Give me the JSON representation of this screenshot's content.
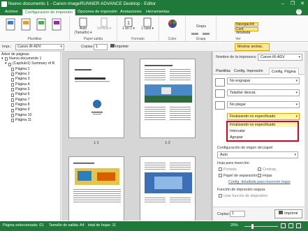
{
  "window": {
    "title": "Nuevo documento 1 - Canon imageRUNNER ADVANCE Desktop - Editor",
    "min": "–",
    "max": "❐",
    "close": "✕"
  },
  "menu_tabs": [
    "Archivo",
    "Configuración de impresión",
    "Opciones de impresión",
    "Anotaciones",
    "Herramientas"
  ],
  "ribbon": {
    "groups": [
      "Plantillas",
      "Papel salida",
      "Formato",
      "Color",
      "Grapa",
      "Ver"
    ],
    "size_label": "Auto\n(Tamaño) ▾",
    "orientation_label": "Vertical ▾",
    "layout_label": "1 en 1 ▾",
    "sides_label": "1 cara ▾",
    "staple_label": "Grapa",
    "view_nav": "Navegación",
    "view_detail": "Conf. detallada"
  },
  "toolbar": {
    "printer_label": "Impr.:",
    "printer_value": "Canon iR-ADV",
    "copies_label": "Copias:",
    "copies_value": "1",
    "print_label": "Imprimir",
    "show_notes": "Mostrar anotac."
  },
  "left": {
    "header": "Árbol de páginas",
    "root": "Nuevo documento 1",
    "doc": "(Capítulo1) Summary of R",
    "pages": [
      "Página 1",
      "Página 2",
      "Página 3",
      "Página 4",
      "Página 5",
      "Página 6",
      "Página 7",
      "Página 8",
      "Página 9",
      "Página 10",
      "Página 11"
    ]
  },
  "center": {
    "labels": [
      "1-1",
      "1-2"
    ]
  },
  "right": {
    "printer_name_label": "Nombre de la impresora:",
    "printer_name_value": "Canon iR-ADV",
    "tabs": [
      "Plantillas",
      "Config. Impresión",
      "Config. Página"
    ],
    "opt1": "No engrapar",
    "opt2": "Taladrar descat.",
    "opt3": "No plegar",
    "opt4": "Finalizando no especificado",
    "paper_source_label": "Configuración de origen del papel",
    "paper_source_value": "Auto",
    "insert_label": "Hoja para inserción",
    "chk_front": "Portada",
    "chk_back": "Contrap.",
    "chk_sep": "Papel de separación",
    "chk_sheets": "Hojas",
    "link_insert": "Config. detallada para inserción hojas",
    "secure_label": "Función de impresión segura",
    "secure_chk": "Usar función de dispositivo",
    "copies_label": "Copias:",
    "copies_value": "1",
    "print_label": "Imprimir"
  },
  "popup": {
    "items": [
      "Finalizando no especificado",
      "Intercalar",
      "Agrupar"
    ]
  },
  "status": {
    "selected": "Página seleccionada: /11",
    "size": "Tamaño de salida: A4",
    "total": "total de hojas: 11",
    "zoom": "25%"
  },
  "colors": {
    "brand": "#1f7a3a",
    "highlight": "#e0001b",
    "selected_row": "#fff4a8"
  }
}
